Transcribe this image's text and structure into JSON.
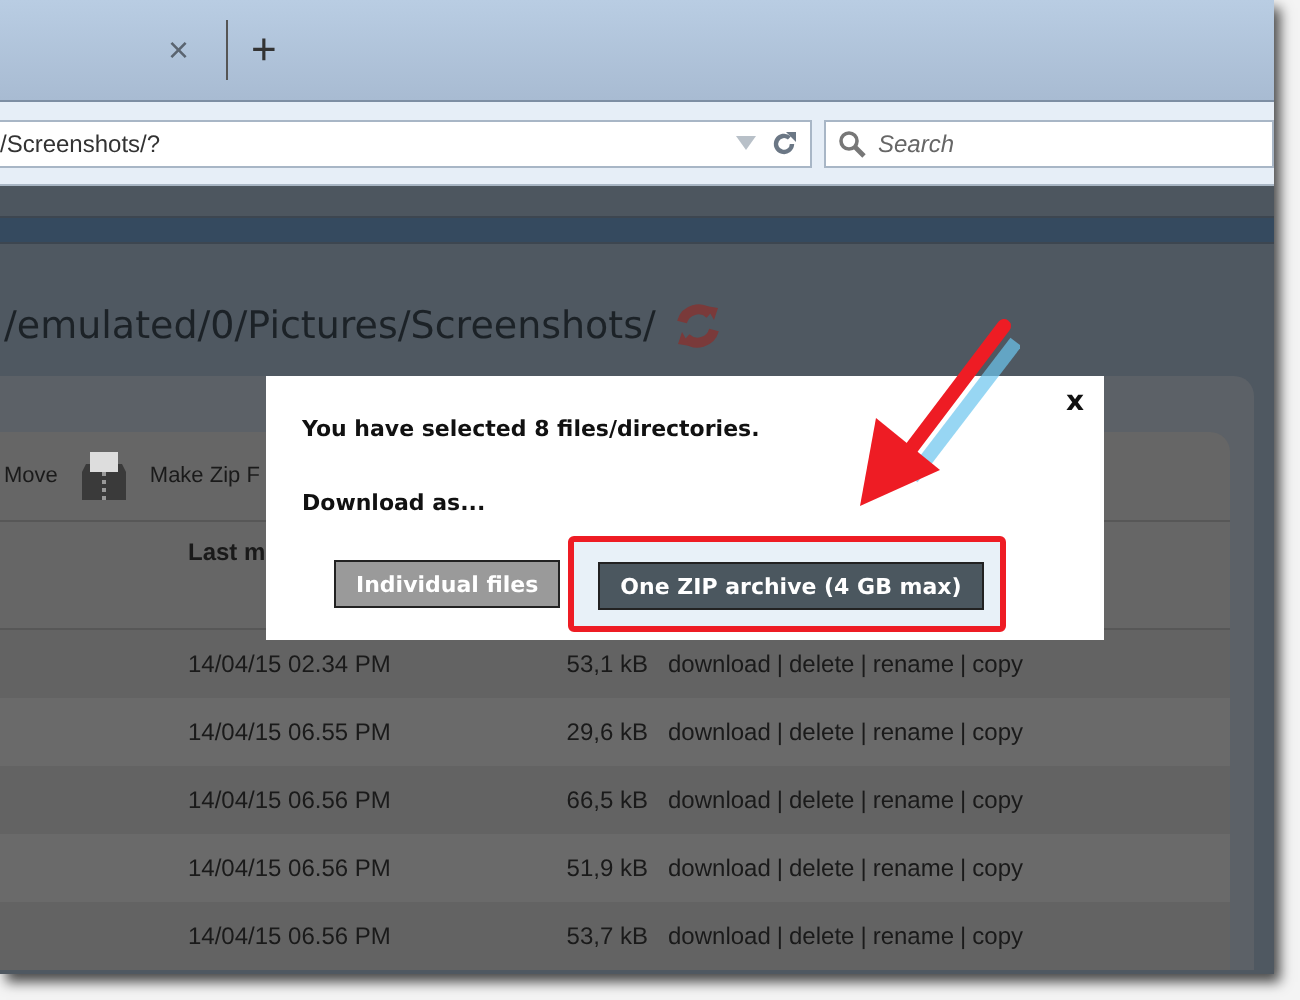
{
  "browser": {
    "tab_close": "×",
    "new_tab": "+",
    "address": "/Screenshots/?",
    "search": {
      "placeholder": "Search"
    }
  },
  "page": {
    "title": "/emulated/0/Pictures/Screenshots/",
    "toolbar": [
      "Move",
      "Make Zip F"
    ],
    "columns": [
      "Last m"
    ],
    "rows": [
      {
        "date": "14/04/15 02.34 PM",
        "size": "53,1 kB",
        "actions": [
          "download",
          "delete",
          "rename",
          "copy"
        ]
      },
      {
        "date": "14/04/15 06.55 PM",
        "size": "29,6 kB",
        "actions": [
          "download",
          "delete",
          "rename",
          "copy"
        ]
      },
      {
        "date": "14/04/15 06.56 PM",
        "size": "66,5 kB",
        "actions": [
          "download",
          "delete",
          "rename",
          "copy"
        ]
      },
      {
        "date": "14/04/15 06.56 PM",
        "size": "51,9 kB",
        "actions": [
          "download",
          "delete",
          "rename",
          "copy"
        ]
      },
      {
        "date": "14/04/15 06.56 PM",
        "size": "53,7 kB",
        "actions": [
          "download",
          "delete",
          "rename",
          "copy"
        ]
      }
    ],
    "separator": "|"
  },
  "dialog": {
    "close": "x",
    "message": "You have selected 8 files/directories.",
    "prompt": "Download as...",
    "buttons": [
      {
        "label": "Individual files",
        "kind": "secondary",
        "highlighted": false
      },
      {
        "label": "One ZIP archive (4 GB max)",
        "kind": "primary",
        "highlighted": true
      }
    ]
  }
}
